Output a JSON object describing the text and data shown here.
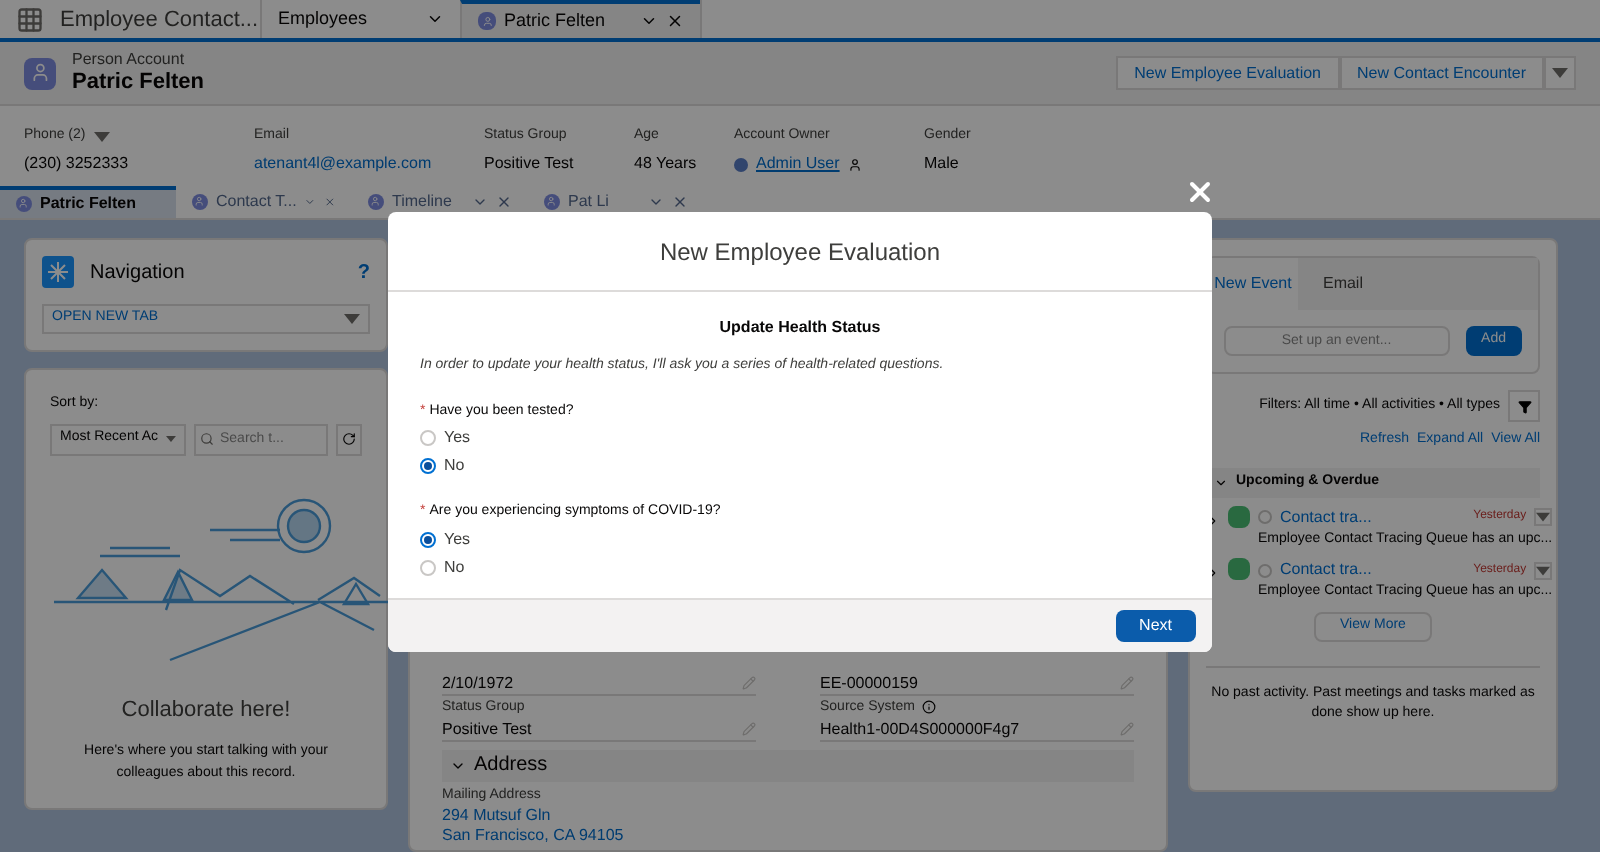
{
  "app": {
    "name": "Employee Contact...",
    "tabs": [
      {
        "label": "Employees",
        "selected": false,
        "closable": false
      },
      {
        "label": "Patric Felten",
        "selected": true,
        "closable": true
      }
    ]
  },
  "record": {
    "type": "Person Account",
    "name": "Patric Felten",
    "actions": [
      "New Employee Evaluation",
      "New Contact Encounter"
    ],
    "fields": [
      {
        "label": "Phone (2)",
        "value": "(230) 3252333",
        "kind": "menu"
      },
      {
        "label": "Email",
        "value": "atenant4l@example.com",
        "kind": "link"
      },
      {
        "label": "Status Group",
        "value": "Positive Test",
        "kind": "text"
      },
      {
        "label": "Age",
        "value": "48 Years",
        "kind": "text"
      },
      {
        "label": "Account Owner",
        "value": "Admin User",
        "kind": "user"
      },
      {
        "label": "Gender",
        "value": "Male",
        "kind": "text"
      }
    ]
  },
  "subtabs": [
    {
      "label": "Patric Felten",
      "selected": true,
      "closable": false
    },
    {
      "label": "Contact T...",
      "selected": false,
      "closable": true
    },
    {
      "label": "Timeline",
      "selected": false,
      "closable": true
    },
    {
      "label": "Pat Li",
      "selected": false,
      "closable": true
    }
  ],
  "navigation": {
    "title": "Navigation",
    "help": "?",
    "select": "OPEN NEW TAB"
  },
  "feed": {
    "sort_label": "Sort by:",
    "sort_value": "Most Recent Ac",
    "search_placeholder": "Search t...",
    "title": "Collaborate here!",
    "text": "Here's where you start talking with your colleagues about this record."
  },
  "details": {
    "rows": [
      [
        {
          "value": "2/10/1972",
          "info": false
        },
        {
          "value": "EE-00000159",
          "info": false
        }
      ],
      [
        {
          "label": "Status Group",
          "value": "Positive Test",
          "info": false
        },
        {
          "label": "Source System",
          "value": "Health1-00D4S000000F4g7",
          "info": true
        }
      ]
    ],
    "section": "Address",
    "address_label": "Mailing Address",
    "address_lines": [
      "294 Mutsuf Gln",
      "San Francisco, CA 94105"
    ]
  },
  "activity": {
    "tabs": [
      {
        "label": "New Event",
        "selected": true
      },
      {
        "label": "Email",
        "selected": false
      }
    ],
    "placeholder": "Set up an event...",
    "add": "Add",
    "filters": "Filters: All time • All activities • All types",
    "links": [
      "Refresh",
      "Expand All",
      "View All"
    ],
    "section": "Upcoming & Overdue",
    "items": [
      {
        "title": "Contact tra...",
        "date": "Yesterday",
        "checked": false,
        "text": "Employee Contact Tracing Queue has an upc..."
      },
      {
        "title": "Contact tra...",
        "date": "Yesterday",
        "checked": false,
        "text": "Employee Contact Tracing Queue has an upc..."
      }
    ],
    "more": "View More",
    "empty": "No past activity. Past meetings and tasks marked as done show up here."
  },
  "modal": {
    "title": "New Employee Evaluation",
    "heading": "Update Health Status",
    "intro": "In order to update your health status, I'll ask you a series of health-related questions.",
    "questions": [
      {
        "label": "Have you been tested?",
        "required": "*",
        "options": [
          {
            "label": "Yes",
            "selected": false
          },
          {
            "label": "No",
            "selected": true
          }
        ]
      },
      {
        "label": "Are you experiencing symptoms of COVID-19?",
        "required": "*",
        "options": [
          {
            "label": "Yes",
            "selected": true
          },
          {
            "label": "No",
            "selected": false
          }
        ]
      }
    ],
    "next": "Next"
  }
}
